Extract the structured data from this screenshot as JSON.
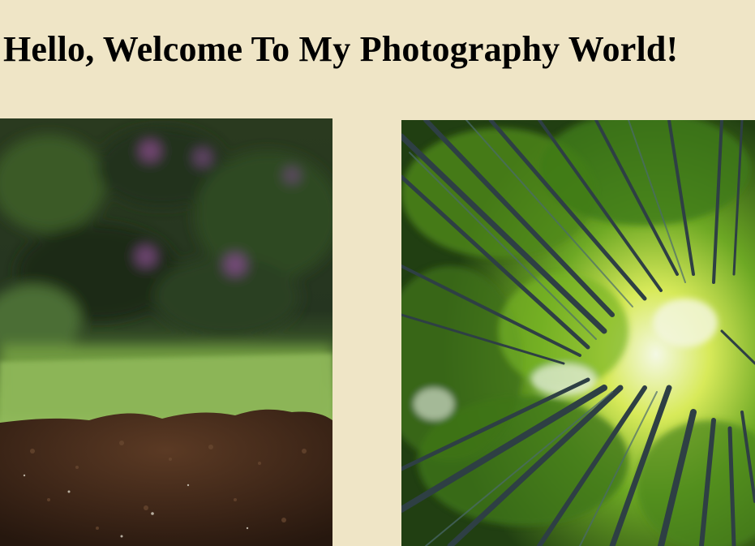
{
  "page": {
    "background_color": "#efe5c6",
    "title": "Hello, Welcome To My Photography World!"
  },
  "gallery": {
    "photos": [
      {
        "subject": "soil-mound-on-grass",
        "palette": [
          "#24301a",
          "#3f6b2a",
          "#8fb85a",
          "#3a2416",
          "#5a3a24"
        ]
      },
      {
        "subject": "bamboo-forest-canopy-looking-up",
        "palette": [
          "#1f3d12",
          "#5f9c1c",
          "#c9e23a",
          "#f2f6e6",
          "#2b3e44"
        ]
      }
    ]
  }
}
